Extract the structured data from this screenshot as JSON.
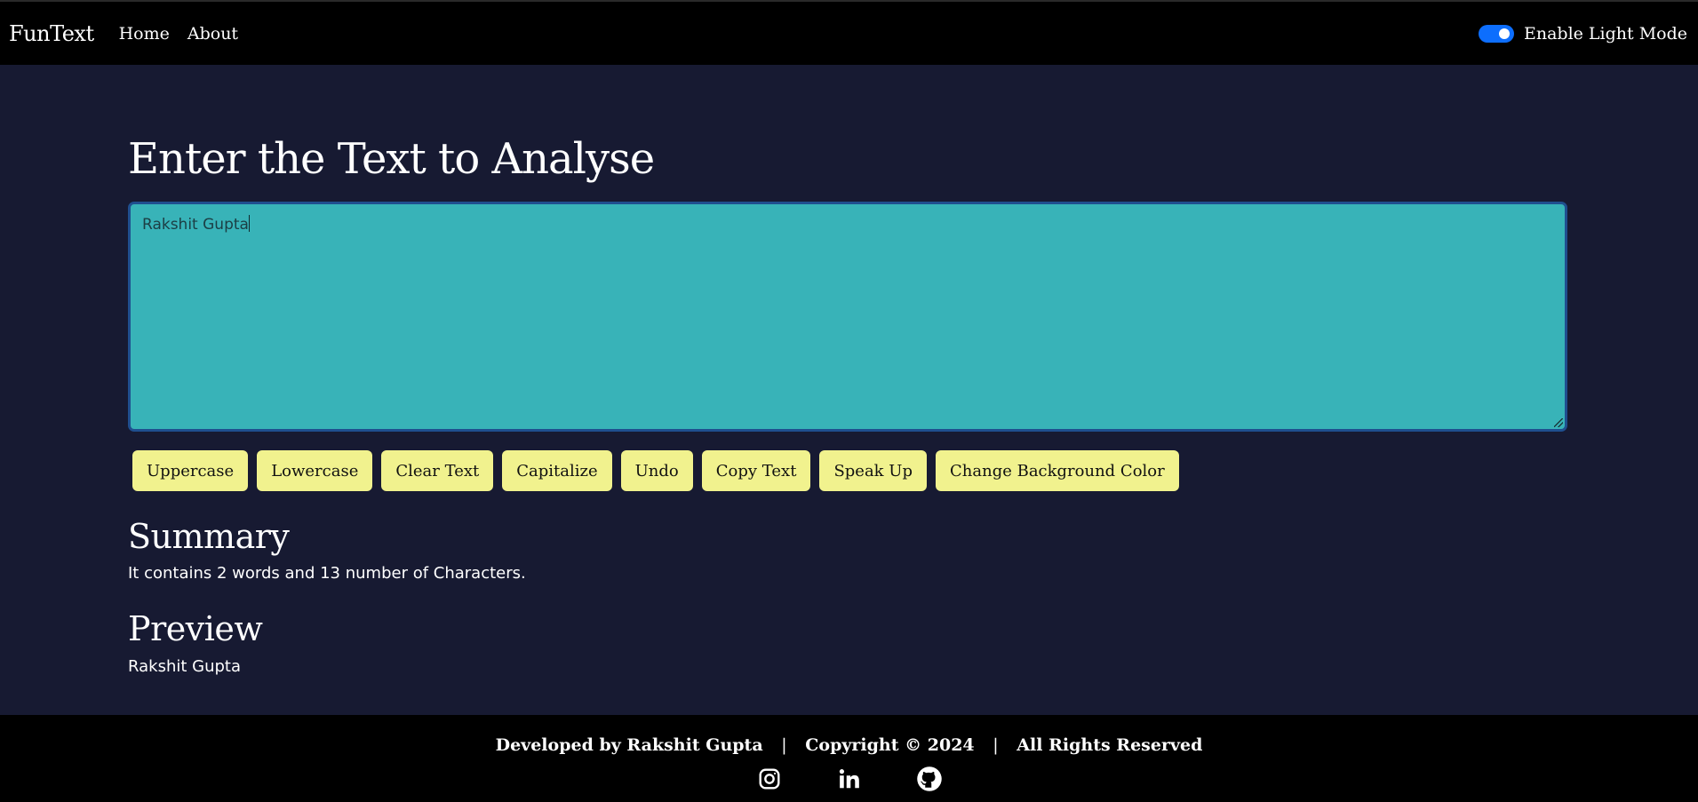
{
  "navbar": {
    "brand": "FunText",
    "links": [
      "Home",
      "About"
    ],
    "toggle_label": "Enable Light Mode",
    "toggle_on": true
  },
  "main": {
    "heading": "Enter the Text to Analyse",
    "textarea_value": "Rakshit Gupta",
    "buttons": [
      "Uppercase",
      "Lowercase",
      "Clear Text",
      "Capitalize",
      "Undo",
      "Copy Text",
      "Speak Up",
      "Change Background Color"
    ],
    "summary_title": "Summary",
    "summary_text": "It contains 2 words and 13 number of Characters.",
    "preview_title": "Preview",
    "preview_text": "Rakshit Gupta"
  },
  "footer": {
    "developed": "Developed by Rakshit Gupta",
    "copyright": "Copyright © 2024",
    "rights": "All Rights Reserved",
    "separator": "|",
    "socials": [
      "instagram-icon",
      "linkedin-icon",
      "github-icon"
    ]
  },
  "colors": {
    "page_bg": "#171a32",
    "navbar_bg": "#000000",
    "textarea_bg": "#38b3b8",
    "button_bg": "#f1f28e",
    "toggle_accent": "#0d6efd"
  }
}
